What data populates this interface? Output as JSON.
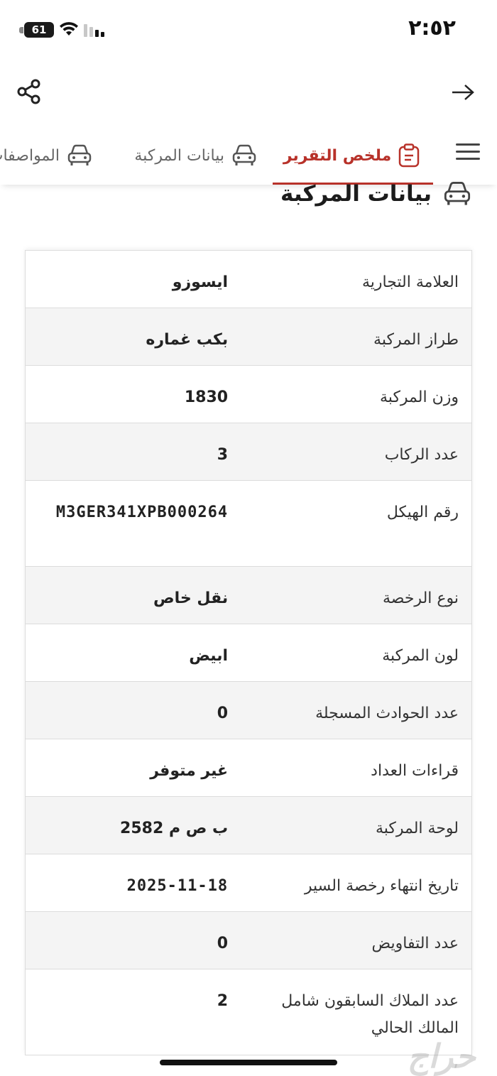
{
  "status_bar": {
    "time": "٢:٥٢",
    "battery_level": "61"
  },
  "header": {
    "share_icon": "share-icon",
    "back_icon": "arrow-right-icon"
  },
  "tabs": [
    {
      "label": "ملخص التقرير",
      "icon": "clipboard-icon",
      "active": true
    },
    {
      "label": "بيانات المركبة",
      "icon": "car-icon",
      "active": false
    },
    {
      "label": "المواصفات",
      "icon": "car-icon",
      "active": false
    }
  ],
  "section": {
    "title": "بيانات المركبة",
    "icon": "car-icon"
  },
  "rows": [
    {
      "label": "العلامة التجارية",
      "value": "ايسوزو"
    },
    {
      "label": "طراز المركبة",
      "value": "بكب غماره"
    },
    {
      "label": "وزن المركبة",
      "value": "1830"
    },
    {
      "label": "عدد الركاب",
      "value": "3"
    },
    {
      "label": "رقم الهيكل",
      "value": "M3GER341XPB000264"
    },
    {
      "label": "نوع الرخصة",
      "value": "نقل خاص"
    },
    {
      "label": "لون المركبة",
      "value": "ابيض"
    },
    {
      "label": "عدد الحوادث المسجلة",
      "value": "0"
    },
    {
      "label": "قراءات العداد",
      "value": "غير متوفر"
    },
    {
      "label": "لوحة المركبة",
      "value": "ب ص م 2582"
    },
    {
      "label": "تاريخ انتهاء رخصة السير",
      "value": "2025-11-18"
    },
    {
      "label": "عدد التفاويض",
      "value": "0"
    },
    {
      "label": "عدد الملاك السابقون شامل المالك الحالي",
      "value": "2"
    }
  ],
  "watermark": "حراج",
  "colors": {
    "accent": "#b8322a",
    "stripe": "#f4f4f4",
    "border": "#dcdcdc"
  }
}
